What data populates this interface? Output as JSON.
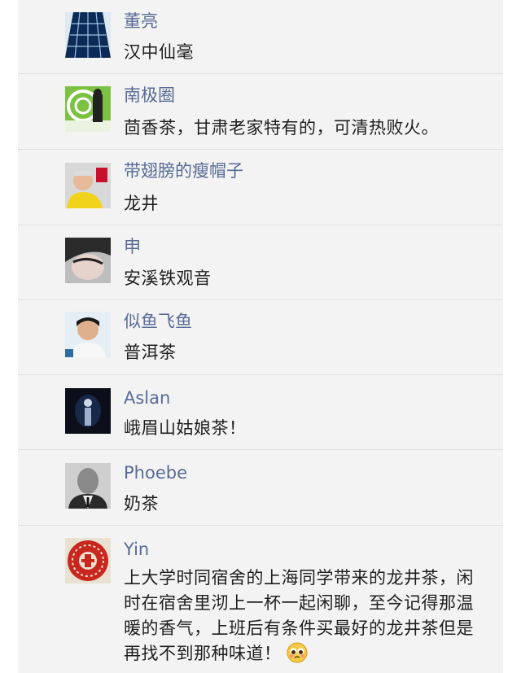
{
  "comments": [
    {
      "avatar": "avatar-skyscraper-icon",
      "name": "董亮",
      "text": "汉中仙毫"
    },
    {
      "avatar": "avatar-green-figure-icon",
      "name": "南极圈",
      "text": "茴香茶，甘肃老家特有的，可清热败火。"
    },
    {
      "avatar": "avatar-man-yellow-shirt-icon",
      "name": "带翅膀的瘦帽子",
      "text": "龙井"
    },
    {
      "avatar": "avatar-woman-portrait-icon",
      "name": "申",
      "text": "安溪铁观音"
    },
    {
      "avatar": "avatar-young-man-icon",
      "name": "似鱼飞鱼",
      "text": "普洱茶"
    },
    {
      "avatar": "avatar-dark-figure-icon",
      "name": "Aslan",
      "text": "峨眉山姑娘茶！"
    },
    {
      "avatar": "avatar-bald-man-icon",
      "name": "Phoebe",
      "text": "奶茶"
    },
    {
      "avatar": "avatar-red-fu-papercut-icon",
      "name": "Yin",
      "text": "上大学时同宿舍的上海同学带来的龙井茶，闲时在宿舍里沏上一杯一起闲聊，至今记得那温暖的香气，上班后有条件买最好的龙井茶但是再找不到那种味道！",
      "emoji": "pleading-face-emoji-icon"
    }
  ]
}
